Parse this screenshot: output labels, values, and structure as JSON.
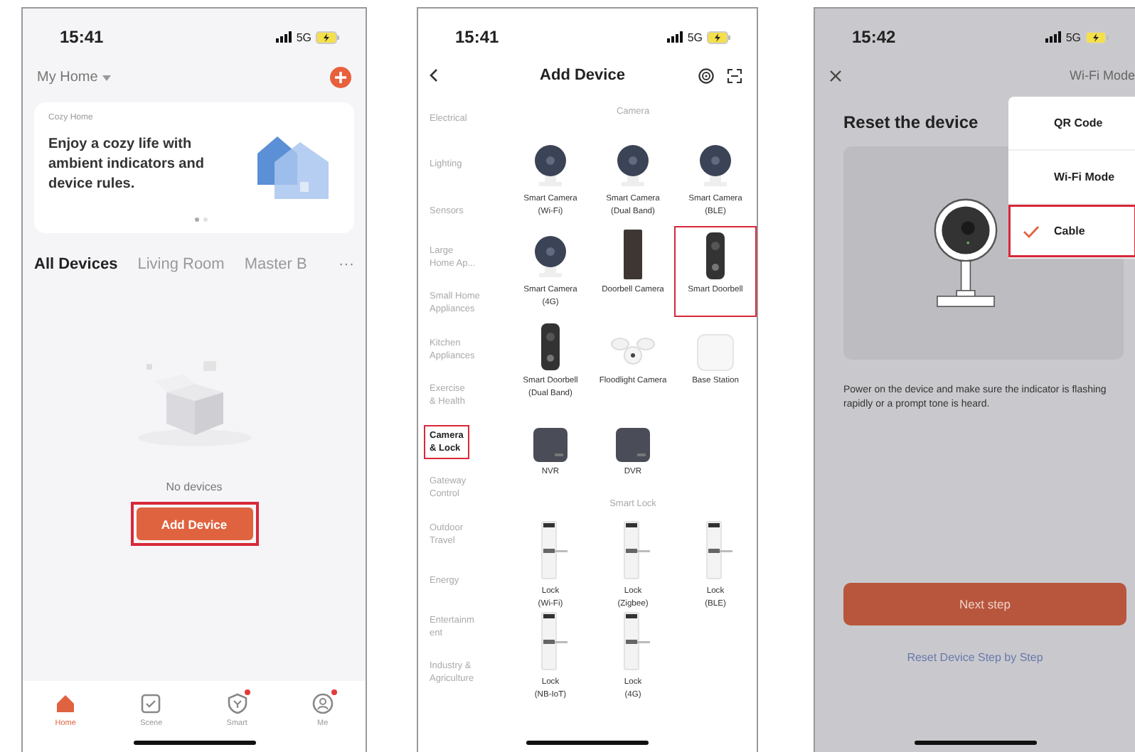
{
  "home": {
    "status": {
      "time": "15:41",
      "network": "5G"
    },
    "home_name": "My Home",
    "banner": {
      "label": "Cozy Home",
      "text": "Enjoy a cozy life with ambient indicators and device rules.",
      "dots": [
        {
          "selected": true
        },
        {
          "selected": false
        }
      ]
    },
    "tabs": [
      {
        "label": "All Devices",
        "selected": true
      },
      {
        "label": "Living Room",
        "selected": false
      },
      {
        "label": "Master B",
        "selected": false
      }
    ],
    "more": "···",
    "empty_text": "No devices",
    "add_button": {
      "label": "Add Device",
      "highlighted": true
    },
    "nav": [
      {
        "label": "Home",
        "kind": "home",
        "selected": true,
        "badge": false
      },
      {
        "label": "Scene",
        "kind": "scene",
        "selected": false,
        "badge": false
      },
      {
        "label": "Smart",
        "kind": "smart",
        "selected": false,
        "badge": true
      },
      {
        "label": "Me",
        "kind": "me",
        "selected": false,
        "badge": true
      }
    ]
  },
  "add_device": {
    "status": {
      "time": "15:41",
      "network": "5G"
    },
    "title": "Add Device",
    "categories": [
      {
        "label": "Electrical",
        "selected": false,
        "highlighted": false
      },
      {
        "label": "Lighting",
        "selected": false,
        "highlighted": false
      },
      {
        "label": "Sensors",
        "selected": false,
        "highlighted": false
      },
      {
        "label": "Large\nHome Ap...",
        "selected": false,
        "highlighted": false
      },
      {
        "label": "Small Home\nAppliances",
        "selected": false,
        "highlighted": false
      },
      {
        "label": "Kitchen\nAppliances",
        "selected": false,
        "highlighted": false
      },
      {
        "label": "Exercise\n& Health",
        "selected": false,
        "highlighted": false
      },
      {
        "label": "Camera\n& Lock",
        "selected": true,
        "highlighted": true
      },
      {
        "label": "Gateway\nControl",
        "selected": false,
        "highlighted": false
      },
      {
        "label": "Outdoor\nTravel",
        "selected": false,
        "highlighted": false
      },
      {
        "label": "Energy",
        "selected": false,
        "highlighted": false
      },
      {
        "label": "Entertainm\nent",
        "selected": false,
        "highlighted": false
      },
      {
        "label": "Industry &\nAgriculture",
        "selected": false,
        "highlighted": false
      }
    ],
    "sections": [
      {
        "title": "Camera",
        "devices": [
          {
            "name": "Smart Camera\n(Wi-Fi)",
            "kind": "camera",
            "highlighted": false
          },
          {
            "name": "Smart Camera\n(Dual Band)",
            "kind": "camera",
            "highlighted": false
          },
          {
            "name": "Smart Camera\n(BLE)",
            "kind": "camera",
            "highlighted": false
          },
          {
            "name": "Smart Camera\n(4G)",
            "kind": "camera",
            "highlighted": false
          },
          {
            "name": "Doorbell Camera",
            "kind": "doorbell",
            "highlighted": false
          },
          {
            "name": "Smart Doorbell",
            "kind": "smart_doorbell",
            "highlighted": true
          },
          {
            "name": "Smart Doorbell\n(Dual Band)",
            "kind": "smart_doorbell",
            "highlighted": false
          },
          {
            "name": "Floodlight Camera",
            "kind": "floodlight",
            "highlighted": false
          },
          {
            "name": "Base Station",
            "kind": "base_station",
            "highlighted": false
          },
          {
            "name": "NVR",
            "kind": "recorder",
            "highlighted": false
          },
          {
            "name": "DVR",
            "kind": "recorder",
            "highlighted": false
          }
        ]
      },
      {
        "title": "Smart Lock",
        "devices": [
          {
            "name": "Lock\n(Wi-Fi)",
            "kind": "lock",
            "highlighted": false
          },
          {
            "name": "Lock\n(Zigbee)",
            "kind": "lock",
            "highlighted": false
          },
          {
            "name": "Lock\n(BLE)",
            "kind": "lock",
            "highlighted": false
          },
          {
            "name": "Lock\n(NB-IoT)",
            "kind": "lock",
            "highlighted": false
          },
          {
            "name": "Lock\n(4G)",
            "kind": "lock",
            "highlighted": false
          }
        ]
      }
    ]
  },
  "reset": {
    "status": {
      "time": "15:42",
      "network": "5G"
    },
    "mode_label": "Wi-Fi Mode",
    "title": "Reset the device",
    "instruction": "Power on the device and make sure the indicator is flashing rapidly or a prompt tone is heard.",
    "next_button": "Next step",
    "help_link": "Reset Device Step by Step",
    "menu": [
      {
        "label": "QR Code",
        "selected": false,
        "highlighted": false
      },
      {
        "label": "Wi-Fi Mode",
        "selected": false,
        "highlighted": false
      },
      {
        "label": "Cable",
        "selected": true,
        "highlighted": true
      }
    ]
  }
}
